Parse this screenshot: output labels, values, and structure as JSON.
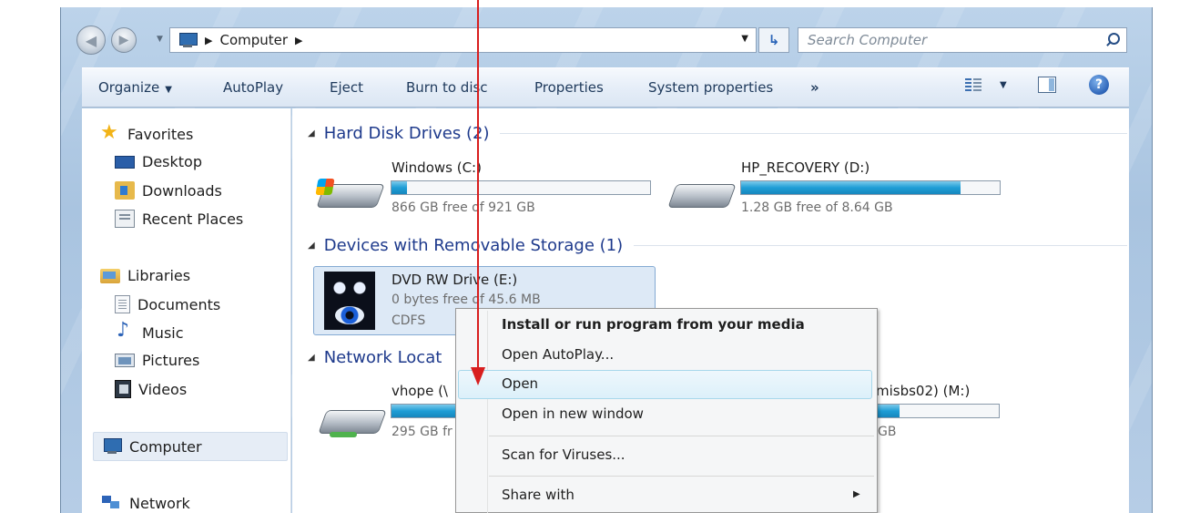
{
  "window": {
    "address_location": "Computer",
    "search_placeholder": "Search Computer"
  },
  "toolbar": {
    "organize": "Organize",
    "autoplay": "AutoPlay",
    "eject": "Eject",
    "burn": "Burn to disc",
    "properties": "Properties",
    "system_properties": "System properties",
    "more": "»",
    "help": "?"
  },
  "sidebar": {
    "favorites": "Favorites",
    "desktop": "Desktop",
    "downloads": "Downloads",
    "recent": "Recent Places",
    "libraries": "Libraries",
    "documents": "Documents",
    "music": "Music",
    "pictures": "Pictures",
    "videos": "Videos",
    "computer": "Computer",
    "network": "Network"
  },
  "groups": {
    "hdd": "Hard Disk Drives (2)",
    "removable": "Devices with Removable Storage (1)",
    "network": "Network Locat"
  },
  "drives": [
    {
      "name": "Windows  (C:)",
      "sub": "866 GB free of 921 GB",
      "used_fraction": 0.06
    },
    {
      "name": "HP_RECOVERY (D:)",
      "sub": "1.28 GB free of 8.64 GB",
      "used_fraction": 0.85
    }
  ],
  "dvd": {
    "name": "DVD RW Drive (E:)",
    "sub": "0 bytes free of 45.6 MB",
    "fs": "CDFS"
  },
  "network_drives": [
    {
      "name": "vhope (\\",
      "sub": "295 GB fr"
    },
    {
      "name": "misbs02) (M:)",
      "sub": "GB"
    }
  ],
  "context_menu": {
    "install": "Install or run program from your media",
    "autoplay": "Open AutoPlay...",
    "open": "Open",
    "open_new": "Open in new window",
    "scan": "Scan for Viruses...",
    "share": "Share with"
  },
  "colors": {
    "annotation_arrow": "#d81e1e",
    "accent_blue": "#1e3a8c",
    "drive_bar": "#1f9ed6"
  }
}
